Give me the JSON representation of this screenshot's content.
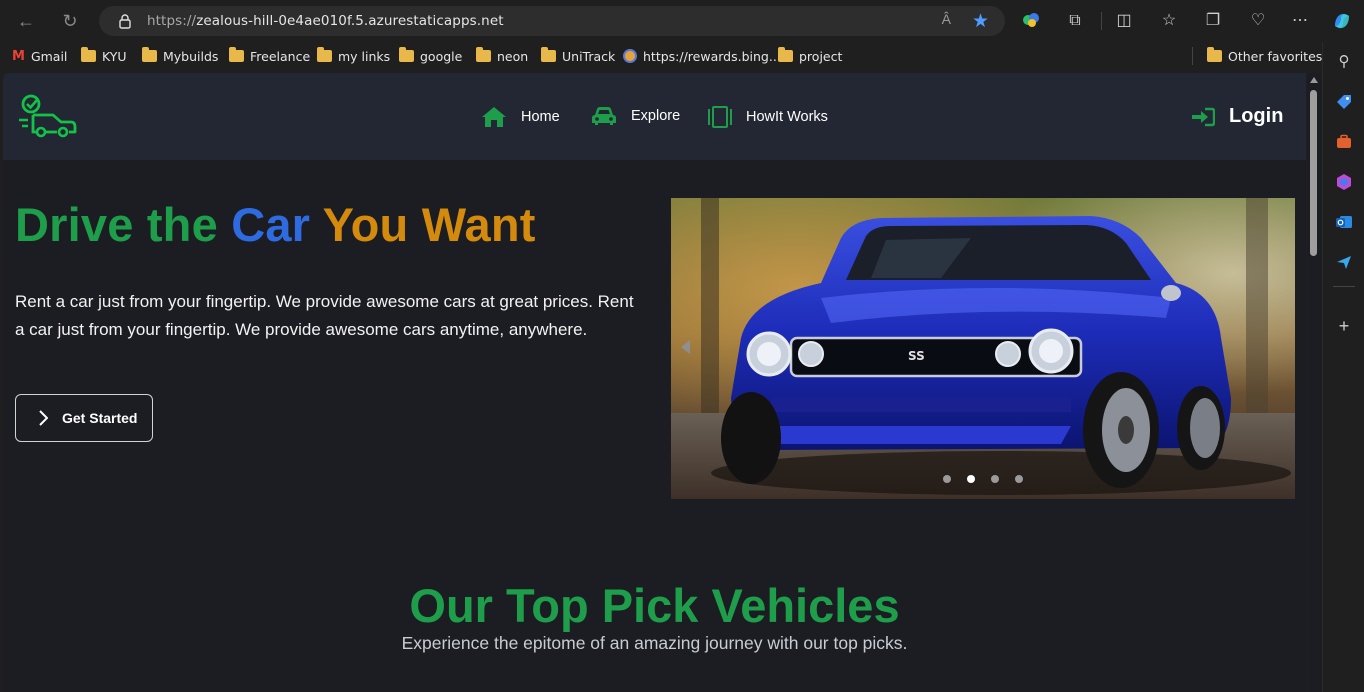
{
  "browser": {
    "url_scheme": "https://",
    "url_host": "zealous-hill-0e4ae010f.5.azurestaticapps.net",
    "read_aloud_label": "Â",
    "bookmarks": [
      {
        "label": "Gmail",
        "icon": "gmail-icon"
      },
      {
        "label": "KYU",
        "icon": "folder-icon"
      },
      {
        "label": "Mybuilds",
        "icon": "folder-icon"
      },
      {
        "label": "Freelance",
        "icon": "folder-icon"
      },
      {
        "label": "my links",
        "icon": "folder-icon"
      },
      {
        "label": "google",
        "icon": "folder-icon"
      },
      {
        "label": "neon",
        "icon": "folder-icon"
      },
      {
        "label": "UniTrack",
        "icon": "folder-icon"
      },
      {
        "label": "https://rewards.bing....",
        "icon": "rewards-icon"
      },
      {
        "label": "project",
        "icon": "folder-icon"
      }
    ],
    "other_favorites": "Other favorites"
  },
  "site": {
    "nav": {
      "home": "Home",
      "explore": "Explore",
      "how": "HowIt Works",
      "login": "Login"
    },
    "hero": {
      "title_part1": "Drive the ",
      "title_part2": "Car",
      "title_part3": " You Want",
      "text": "Rent a car just from your fingertip. We provide awesome cars at great prices. Rent a car just from your fingertip. We provide awesome cars anytime, anywhere.",
      "cta": "Get Started"
    },
    "carousel": {
      "slide_count": 4,
      "active_index": 1,
      "badge": "SS"
    },
    "picks": {
      "title": "Our Top Pick Vehicles",
      "subtitle": "Experience the epitome of an amazing journey with our top picks."
    }
  },
  "colors": {
    "brand_green": "#1e9e4a",
    "brand_blue": "#2f6be0",
    "brand_orange": "#d48a0c",
    "header_bg": "#222733",
    "page_bg": "#1b1d22"
  }
}
